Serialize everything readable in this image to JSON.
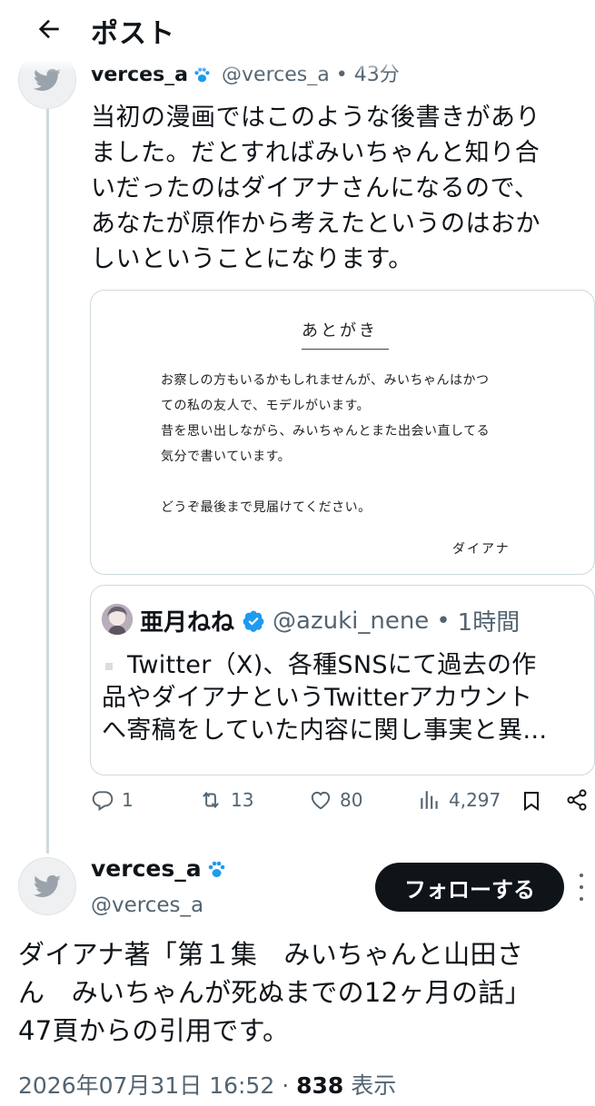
{
  "header": {
    "title": "ポスト"
  },
  "parent_tweet": {
    "display_name": "verces_a",
    "handle": "@verces_a",
    "separator": "•",
    "time": "43分",
    "body_lines": [
      "当初の漫画ではこのような後書きがあり",
      "ました。だとすればみいちゃんと知り合",
      "いだったのはダイアナさんになるので、",
      "あなたが原作から考えたというのはおか",
      "しいということになります。"
    ],
    "image": {
      "title": "あとがき",
      "lines": [
        "お察しの方もいるかもしれませんが、みいちゃんはかつ",
        "ての私の友人で、モデルがいます。",
        "昔を思い出しながら、みいちゃんとまた出会い直してる",
        "気分で書いています。",
        "どうぞ最後まで見届けてください。"
      ],
      "signature": "ダイアナ"
    },
    "quote": {
      "display_name": "亜月ねね",
      "handle": "@azuki_nene",
      "separator": "•",
      "time": "1時間",
      "body_lines": [
        "Twitter（X)、各種SNSにて過去の作",
        "品やダイアナというTwitterアカウント",
        "へ寄稿をしていた内容に関し事実と異…"
      ]
    },
    "actions": {
      "replies": "1",
      "reposts": "13",
      "likes": "80",
      "views": "4,297"
    },
    "colors": {
      "verified_badge": "#1d9bf0",
      "icon_gray": "#536471"
    },
    "icons": [
      "reply-icon",
      "repost-icon",
      "like-icon",
      "views-icon",
      "bookmark-icon",
      "share-icon"
    ]
  },
  "main_tweet": {
    "display_name": "verces_a",
    "handle": "@verces_a",
    "follow_label": "フォローする",
    "body_lines": [
      "ダイアナ著「第１集　みいちゃんと山田さ",
      "ん　みいちゃんが死ぬまでの12ヶ月の話」",
      "47頁からの引用です。"
    ],
    "timestamp": "2026年07月31日 16:52",
    "separator": "·",
    "view_count": "838",
    "view_label": "表示"
  }
}
